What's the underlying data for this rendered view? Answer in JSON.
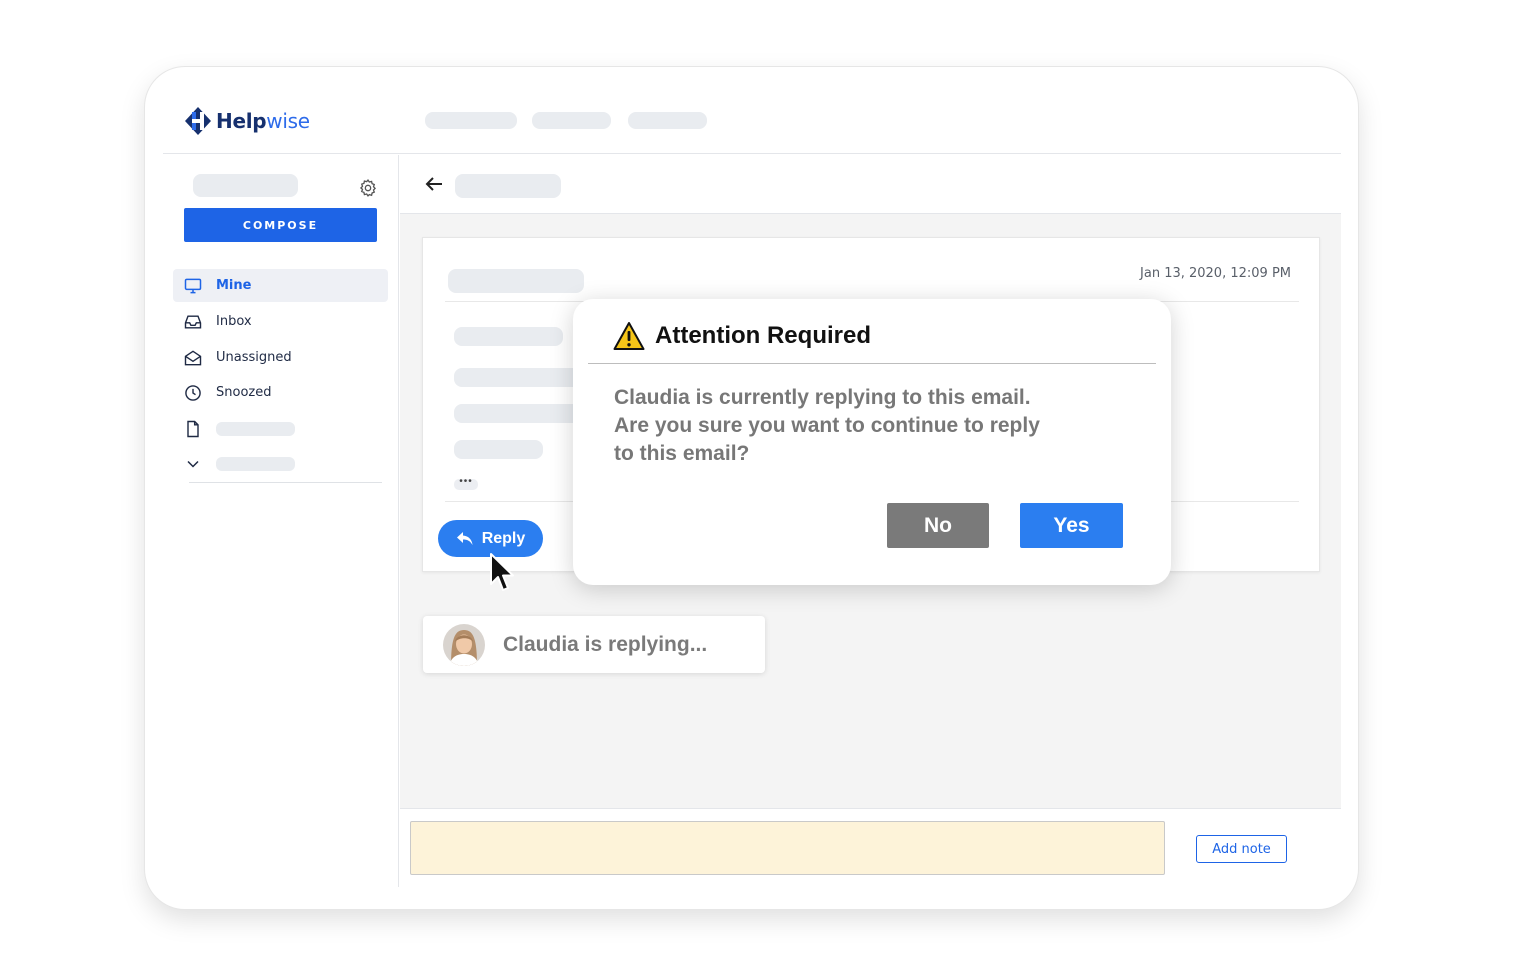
{
  "app": {
    "logo_help": "Help",
    "logo_wise": "wise"
  },
  "sidebar": {
    "compose_label": "COMPOSE",
    "items": [
      {
        "label": "Mine",
        "icon": "monitor-icon",
        "active": true
      },
      {
        "label": "Inbox",
        "icon": "inbox-icon"
      },
      {
        "label": "Unassigned",
        "icon": "envelope-open-icon"
      },
      {
        "label": "Snoozed",
        "icon": "clock-icon"
      }
    ]
  },
  "email": {
    "date": "Jan 13, 2020, 12:09 PM",
    "reply_label": "Reply"
  },
  "typing_indicator": {
    "text": "Claudia is replying..."
  },
  "composer": {
    "add_note_label": "Add note"
  },
  "modal": {
    "title": "Attention Required",
    "body_lines": [
      "Claudia is currently replying to this email.",
      "Are you sure you want to continue to reply",
      "to this email?"
    ],
    "no_label": "No",
    "yes_label": "Yes"
  },
  "colors": {
    "primary": "#1e64e6",
    "reply_blue": "#2b7ef0",
    "no_gray": "#7a7a7a",
    "note_bg": "#fdf3d9",
    "warning": "#f5c518"
  }
}
